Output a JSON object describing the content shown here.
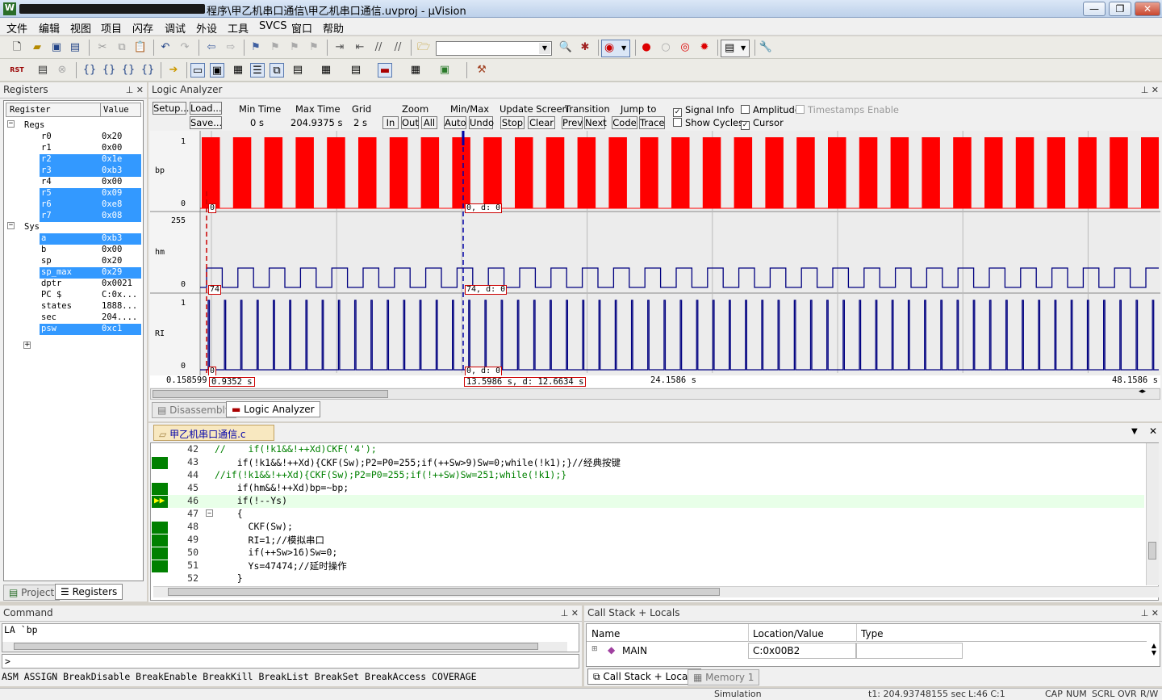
{
  "window": {
    "title": "程序\\甲乙机串口通信\\甲乙机串口通信.uvproj - µVision",
    "icon": "W",
    "min": "—",
    "max": "❐",
    "close": "✕"
  },
  "menu": [
    "文件",
    "编辑",
    "视图",
    "项目",
    "闪存",
    "调试",
    "外设",
    "工具",
    "SVCS",
    "窗口",
    "帮助"
  ],
  "registers": {
    "title": "Registers",
    "col_name": "Register",
    "col_value": "Value",
    "groups": [
      {
        "label": "Regs"
      },
      {
        "label": "Sys"
      }
    ],
    "rows": [
      {
        "n": "r0",
        "v": "0x20",
        "sel": false
      },
      {
        "n": "r1",
        "v": "0x00",
        "sel": false
      },
      {
        "n": "r2",
        "v": "0x1e",
        "sel": true
      },
      {
        "n": "r3",
        "v": "0xb3",
        "sel": true
      },
      {
        "n": "r4",
        "v": "0x00",
        "sel": false
      },
      {
        "n": "r5",
        "v": "0x09",
        "sel": true
      },
      {
        "n": "r6",
        "v": "0xe8",
        "sel": true
      },
      {
        "n": "r7",
        "v": "0x08",
        "sel": true
      },
      {
        "n": "a",
        "v": "0xb3",
        "sel": true
      },
      {
        "n": "b",
        "v": "0x00",
        "sel": false
      },
      {
        "n": "sp",
        "v": "0x20",
        "sel": false
      },
      {
        "n": "sp_max",
        "v": "0x29",
        "sel": true
      },
      {
        "n": "dptr",
        "v": "0x0021",
        "sel": false
      },
      {
        "n": "PC  $",
        "v": "C:0x...",
        "sel": false
      },
      {
        "n": "states",
        "v": "1888...",
        "sel": false
      },
      {
        "n": "sec",
        "v": "204....",
        "sel": false
      },
      {
        "n": "psw",
        "v": "0xc1",
        "sel": true
      }
    ],
    "tabs": [
      "Project",
      "Registers"
    ]
  },
  "logic": {
    "title": "Logic Analyzer",
    "setup": "Setup...",
    "load": "Load...",
    "save": "Save...",
    "min_time_label": "Min Time",
    "min_time": "0 s",
    "max_time_label": "Max Time",
    "max_time": "204.9375 s",
    "grid_label": "Grid",
    "grid": "2 s",
    "zoom_label": "Zoom",
    "zoom_in": "In",
    "zoom_out": "Out",
    "zoom_all": "All",
    "minmax_label": "Min/Max",
    "auto": "Auto",
    "undo": "Undo",
    "update_label": "Update Screen",
    "stop": "Stop",
    "clear": "Clear",
    "transition_label": "Transition",
    "prev": "Prev",
    "next": "Next",
    "jump_label": "Jump to",
    "code": "Code",
    "trace": "Trace",
    "signal_info": "Signal Info",
    "show_cycles": "Show Cycles",
    "amplitude": "Amplitude",
    "cursor": "Cursor",
    "timestamps": "Timestamps Enable",
    "signals": [
      {
        "name": "bp",
        "hi": "1",
        "lo": "0"
      },
      {
        "name": "hm",
        "hi": "255",
        "lo": "0"
      },
      {
        "name": "RI",
        "hi": "1",
        "lo": "0"
      }
    ],
    "markers": {
      "bp_a": "0",
      "bp_b": "0,   d: 0",
      "hm_a": "74",
      "hm_b": "74,   d: 0",
      "ri_a": "0",
      "ri_b": "0,   d: 0"
    },
    "axis": {
      "start": "0.158599",
      "t1": "0.9352 s",
      "t2": "13.5986 s,   d: 12.6634 s",
      "mid": "24.1586 s",
      "end": "48.1586 s"
    },
    "tabs": [
      "Disassembly",
      "Logic Analyzer"
    ]
  },
  "editor": {
    "file": "甲乙机串口通信.c",
    "lines": [
      {
        "n": "42",
        "t": "//    if(!k1&&!++Xd)CKF('4');"
      },
      {
        "n": "43",
        "t": "    if(!k1&&!++Xd){CKF(Sw);P2=P0=255;if(++Sw>9)Sw=0;while(!k1);}//经典按键"
      },
      {
        "n": "44",
        "t": "//if(!k1&&!++Xd){CKF(Sw);P2=P0=255;if(!++Sw)Sw=251;while(!k1);}"
      },
      {
        "n": "45",
        "t": "    if(hm&&!++Xd)bp=~bp;"
      },
      {
        "n": "46",
        "t": "    if(!--Ys)"
      },
      {
        "n": "47",
        "t": "    {"
      },
      {
        "n": "48",
        "t": "      CKF(Sw);"
      },
      {
        "n": "49",
        "t": "      RI=1;//模拟串口"
      },
      {
        "n": "50",
        "t": "      if(++Sw>16)Sw=0;"
      },
      {
        "n": "51",
        "t": "      Ys=47474;//延时操作"
      },
      {
        "n": "52",
        "t": "    }"
      }
    ]
  },
  "command": {
    "title": "Command",
    "line": "LA `bp",
    "prompt": ">",
    "hint": "ASM ASSIGN BreakDisable BreakEnable BreakKill BreakList BreakSet BreakAccess COVERAGE"
  },
  "callstack": {
    "title": "Call Stack + Locals",
    "col_name": "Name",
    "col_loc": "Location/Value",
    "col_type": "Type",
    "row_name": "MAIN",
    "row_loc": "C:0x00B2",
    "tabs": [
      "Call Stack + Locals",
      "Memory 1"
    ]
  },
  "status": {
    "mode": "Simulation",
    "time": "t1: 204.93748155 sec",
    "pos": "L:46 C:1",
    "caps": "CAP",
    "num": "NUM",
    "scrl": "SCRL",
    "ovr": "OVR",
    "rw": "R/W"
  },
  "colors": {
    "signal_red": "#ff0000",
    "signal_blue": "#000080",
    "selection": "#3399ff"
  }
}
